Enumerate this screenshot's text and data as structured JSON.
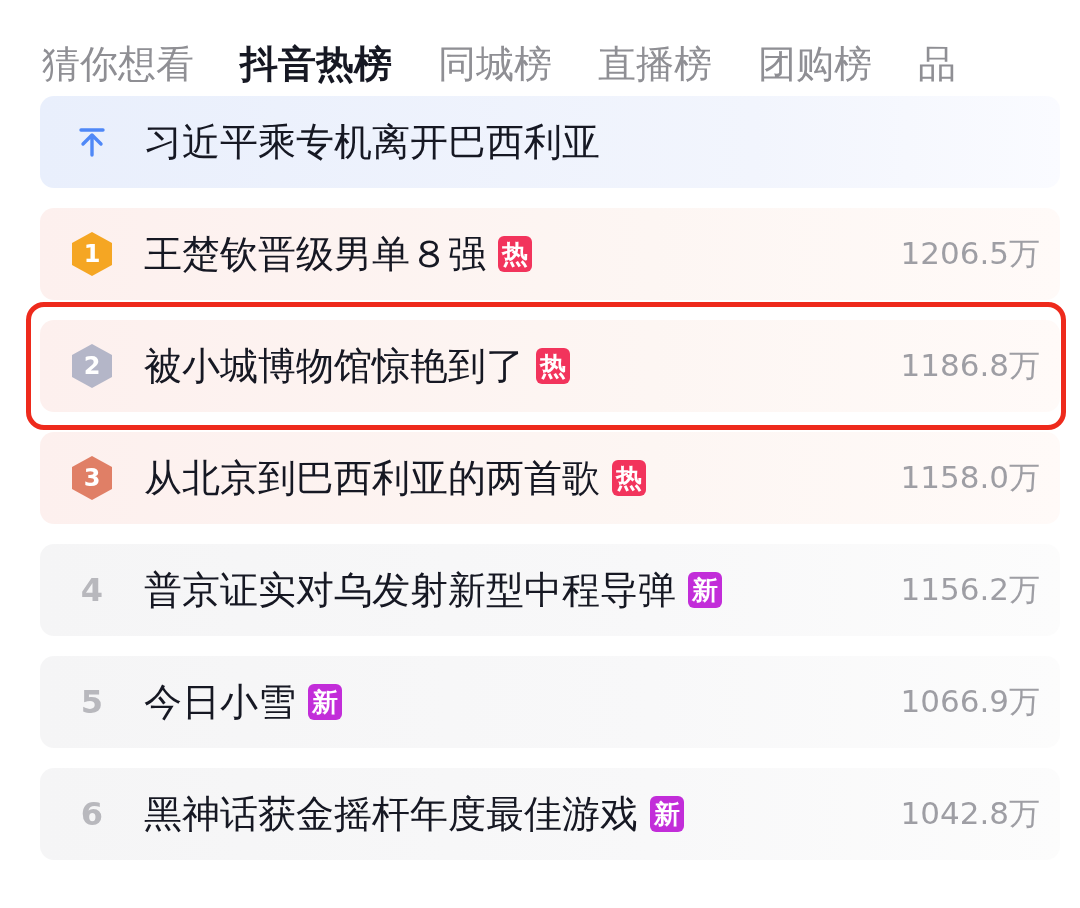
{
  "tabs": [
    {
      "label": "猜你想看",
      "selected": false
    },
    {
      "label": "抖音热榜",
      "selected": true
    },
    {
      "label": "同城榜",
      "selected": false
    },
    {
      "label": "直播榜",
      "selected": false
    },
    {
      "label": "团购榜",
      "selected": false
    },
    {
      "label": "品",
      "selected": false
    }
  ],
  "items": [
    {
      "kind": "pinned",
      "title": "习近平乘专机离开巴西利亚",
      "highlighted": false
    },
    {
      "kind": "medal",
      "rank": "1",
      "color": "#f5a623",
      "title": "王楚钦晋级男单８强",
      "tag": {
        "text": "热",
        "color": "#f2345c"
      },
      "heat": "1206.5万",
      "highlighted": false
    },
    {
      "kind": "medal",
      "rank": "2",
      "color": "#b4b6c8",
      "title": "被小城博物馆惊艳到了",
      "tag": {
        "text": "热",
        "color": "#f2345c"
      },
      "heat": "1186.8万",
      "highlighted": true
    },
    {
      "kind": "medal",
      "rank": "3",
      "color": "#e07f66",
      "title": "从北京到巴西利亚的两首歌",
      "tag": {
        "text": "热",
        "color": "#f2345c"
      },
      "heat": "1158.0万",
      "highlighted": false
    },
    {
      "kind": "plain",
      "rank": "4",
      "title": "普京证实对乌发射新型中程导弹",
      "tag": {
        "text": "新",
        "color": "#c22dd9"
      },
      "heat": "1156.2万",
      "highlighted": false
    },
    {
      "kind": "plain",
      "rank": "5",
      "title": "今日小雪",
      "tag": {
        "text": "新",
        "color": "#c22dd9"
      },
      "heat": "1066.9万",
      "highlighted": false
    },
    {
      "kind": "plain",
      "rank": "6",
      "title": "黑神话获金摇杆年度最佳游戏",
      "tag": {
        "text": "新",
        "color": "#c22dd9"
      },
      "heat": "1042.8万",
      "highlighted": false
    }
  ]
}
